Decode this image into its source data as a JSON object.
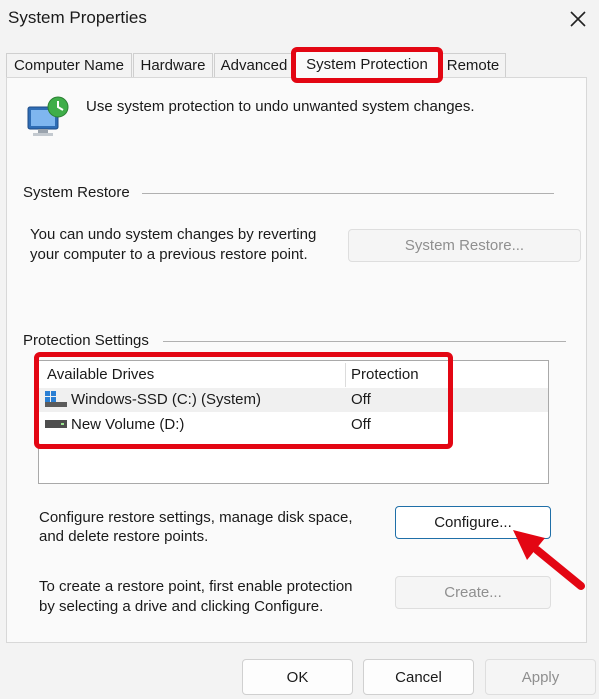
{
  "window": {
    "title": "System Properties"
  },
  "tabs": [
    {
      "label": "Computer Name",
      "active": false
    },
    {
      "label": "Hardware",
      "active": false
    },
    {
      "label": "Advanced",
      "active": false
    },
    {
      "label": "System Protection",
      "active": true
    },
    {
      "label": "Remote",
      "active": false
    }
  ],
  "intro": {
    "text": "Use system protection to undo unwanted system changes."
  },
  "system_restore": {
    "group_label": "System Restore",
    "description_line1": "You can undo system changes by reverting",
    "description_line2": "your computer to a previous restore point.",
    "button_label": "System Restore..."
  },
  "protection_settings": {
    "group_label": "Protection Settings",
    "columns": [
      "Available Drives",
      "Protection"
    ],
    "drives": [
      {
        "name": "Windows-SSD (C:) (System)",
        "protection": "Off",
        "icon": "system-drive-icon"
      },
      {
        "name": "New Volume (D:)",
        "protection": "Off",
        "icon": "hard-drive-icon"
      }
    ],
    "configure_text_line1": "Configure restore settings, manage disk space,",
    "configure_text_line2": "and delete restore points.",
    "configure_button": "Configure...",
    "create_text_line1": "To create a restore point, first enable protection",
    "create_text_line2": "by selecting a drive and clicking Configure.",
    "create_button": "Create..."
  },
  "footer": {
    "ok": "OK",
    "cancel": "Cancel",
    "apply": "Apply"
  },
  "colors": {
    "highlight": "#e30613",
    "accent": "#1f6fa8"
  }
}
